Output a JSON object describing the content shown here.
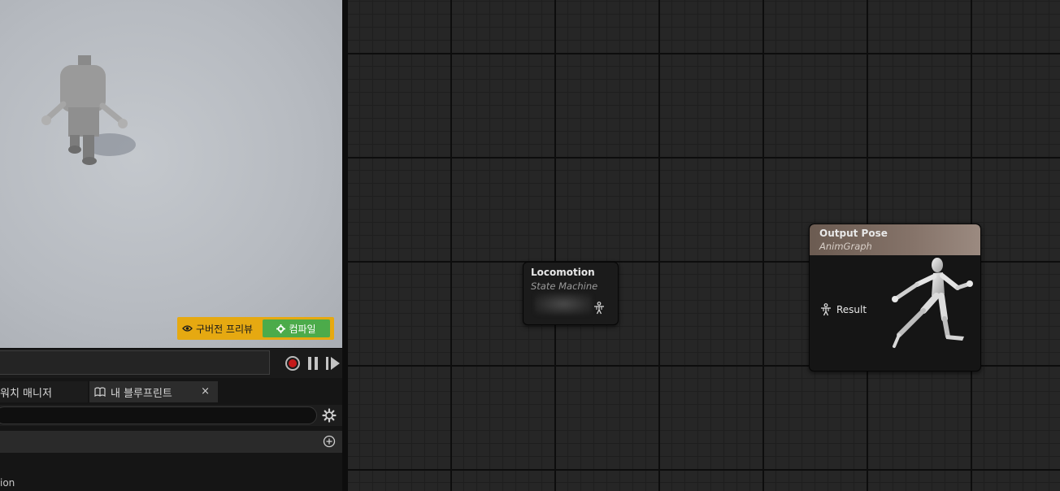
{
  "viewport": {
    "preview_label": "구버전 프리뷰",
    "compile_label": "컴파일"
  },
  "bottom_panel": {
    "tabs": [
      {
        "label": "워치 매니저"
      },
      {
        "label": "내 블루프린트"
      }
    ],
    "tab_close": "×",
    "search": {
      "value": "",
      "placeholder": ""
    },
    "list_item_partial": "ion"
  },
  "graph": {
    "nodes": [
      {
        "title": "Locomotion",
        "subtitle": "State Machine"
      },
      {
        "title": "Output Pose",
        "subtitle": "AnimGraph",
        "pin_label": "Result"
      }
    ]
  },
  "colors": {
    "preview_banner": "#e6a911",
    "compile_button": "#4cab4a",
    "record": "#c41a1a",
    "output_header": "#857369"
  }
}
